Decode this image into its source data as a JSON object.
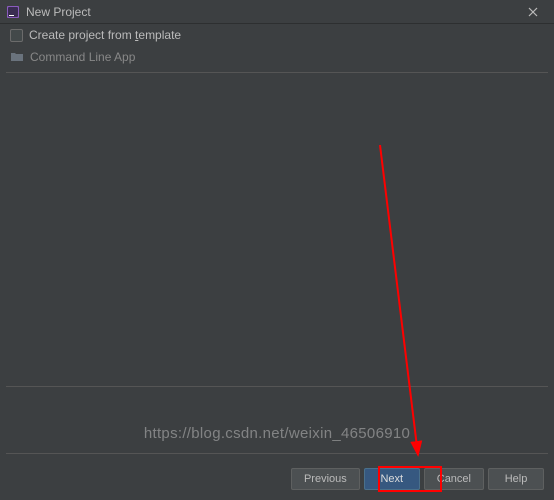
{
  "titlebar": {
    "title": "New Project"
  },
  "option": {
    "label_pre": "Create project from ",
    "label_u": "t",
    "label_post": "emplate"
  },
  "list": {
    "item1": "Command Line App"
  },
  "buttons": {
    "previous": "Previous",
    "next": "Next",
    "cancel": "Cancel",
    "help": "Help"
  },
  "watermark": "https://blog.csdn.net/weixin_46506910"
}
